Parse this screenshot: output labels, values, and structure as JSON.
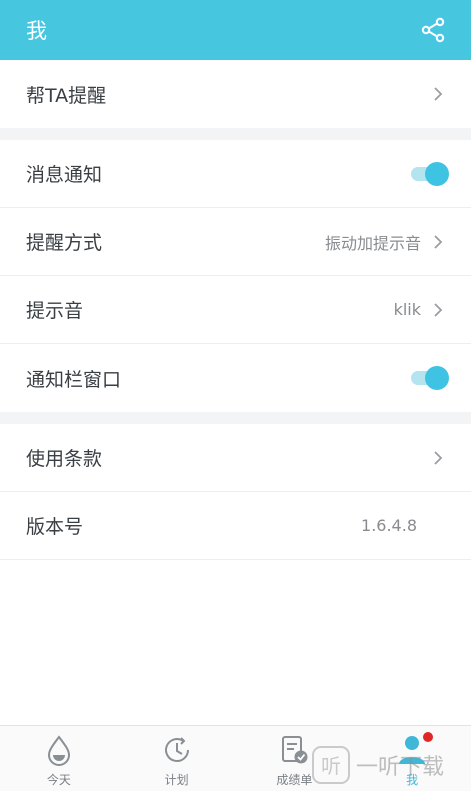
{
  "header": {
    "title": "我",
    "share_icon": "share-icon",
    "bg_color": "#47c6e0"
  },
  "rows": {
    "remind_ta": {
      "label": "帮TA提醒"
    },
    "notifications": {
      "label": "消息通知",
      "enabled": true
    },
    "remind_method": {
      "label": "提醒方式",
      "value": "振动加提示音"
    },
    "sound": {
      "label": "提示音",
      "value": "klik"
    },
    "notification_bar": {
      "label": "通知栏窗口",
      "enabled": true
    },
    "terms": {
      "label": "使用条款"
    },
    "version": {
      "label": "版本号",
      "value": "1.6.4.8"
    }
  },
  "tabs": [
    {
      "label": "今天",
      "icon": "water-drop-icon",
      "active": false
    },
    {
      "label": "计划",
      "icon": "clock-icon",
      "active": false
    },
    {
      "label": "成绩单",
      "icon": "report-icon",
      "active": false
    },
    {
      "label": "我",
      "icon": "user-icon",
      "active": true,
      "badge": true
    }
  ],
  "watermark": {
    "text": "一听下载"
  },
  "accent_color": "#3fc3e2"
}
